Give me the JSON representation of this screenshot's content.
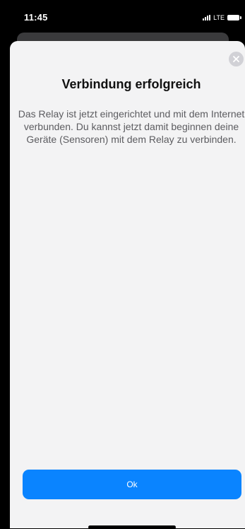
{
  "status_bar": {
    "time": "11:45",
    "network": "LTE",
    "icons": [
      "signal-icon",
      "battery-icon"
    ]
  },
  "dialog": {
    "title": "Verbindung erfolgreich",
    "message": "Das Relay ist jetzt eingerichtet und mit dem Internet verbunden. Du kannst jetzt damit beginnen deine Geräte (Sensoren) mit dem Relay zu verbinden.",
    "ok_label": "Ok",
    "close_icon": "close-icon"
  },
  "colors": {
    "accent": "#0a84ff",
    "sheet_background": "#f3f3f4",
    "title_text": "#111111",
    "body_text": "#5c5c60"
  }
}
